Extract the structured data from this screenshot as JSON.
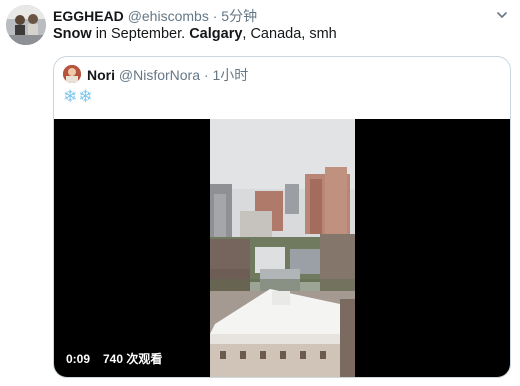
{
  "tweet": {
    "author_name": "EGGHEAD",
    "author_handle": "@ehiscombs",
    "separator": "·",
    "time": "5分钟",
    "text_parts": [
      "Snow",
      " in September. ",
      "Calgary",
      ", Canada, smh"
    ]
  },
  "quoted": {
    "author_name": "Nori",
    "author_handle": "@NisforNora",
    "separator": "·",
    "time": "1小时",
    "text": "❄❄"
  },
  "video": {
    "duration": "0:09",
    "views": "740 次观看"
  },
  "icons": {
    "menu": "chevron-down-icon",
    "play": "video-frame"
  },
  "colors": {
    "secondary_text": "#657786",
    "border": "#ccd6dd",
    "snowflake": "#7fc6ec"
  }
}
